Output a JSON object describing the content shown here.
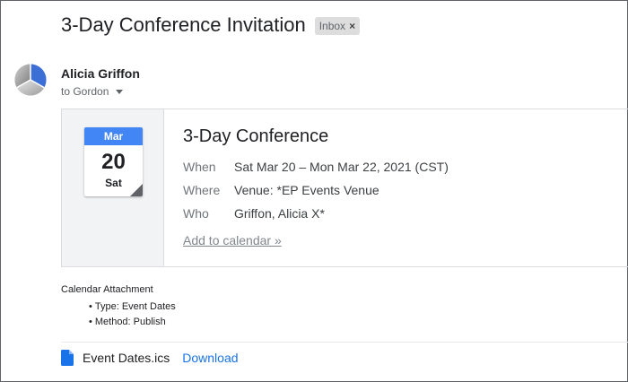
{
  "email": {
    "subject": "3-Day Conference Invitation",
    "label": "Inbox",
    "label_remove": "×",
    "sender": "Alicia Griffon",
    "recipient": "to Gordon"
  },
  "invite": {
    "month": "Mar",
    "day": "20",
    "weekday": "Sat",
    "title": "3-Day Conference",
    "when_label": "When",
    "when_value": "Sat Mar 20 – Mon Mar 22, 2021 (CST)",
    "where_label": "Where",
    "where_value": "Venue: *EP Events Venue",
    "who_label": "Who",
    "who_value": "Griffon, Alicia X*",
    "add_to_calendar": "Add to calendar »"
  },
  "attachment_info": {
    "heading": "Calendar Attachment",
    "items": [
      "Type: Event Dates",
      "Method: Publish"
    ]
  },
  "file": {
    "name": "Event Dates.ics",
    "download_label": "Download"
  },
  "colors": {
    "accent": "#1a73e8",
    "calendar_header": "#4285f4",
    "label_chip": "#dddddd"
  },
  "icons": {
    "avatar": "pie-avatar-icon",
    "file": "file-icon",
    "dropdown": "chevron-down-icon"
  }
}
